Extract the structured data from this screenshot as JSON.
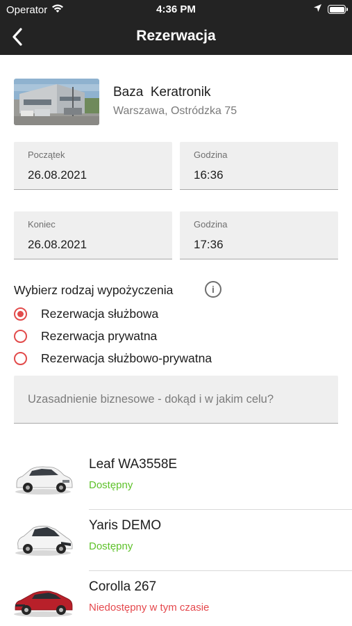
{
  "status_bar": {
    "carrier": "Operator",
    "time": "4:36 PM"
  },
  "nav": {
    "title": "Rezerwacja"
  },
  "location": {
    "name": "Baza  Keratronik",
    "address": "Warszawa, Ostródzka 75"
  },
  "start": {
    "date_label": "Początek",
    "date": "26.08.2021",
    "time_label": "Godzina",
    "time": "16:36"
  },
  "end": {
    "date_label": "Koniec",
    "date": "26.08.2021",
    "time_label": "Godzina",
    "time": "17:36"
  },
  "rental_type": {
    "title": "Wybierz rodzaj wypożyczenia",
    "options": [
      {
        "label": "Rezerwacja służbowa",
        "selected": true
      },
      {
        "label": "Rezerwacja prywatna",
        "selected": false
      },
      {
        "label": "Rezerwacja służbowo-prywatna",
        "selected": false
      }
    ]
  },
  "justification": {
    "placeholder": "Uzasadnienie biznesowe - dokąd i w jakim celu?"
  },
  "cars": [
    {
      "name": "Leaf WA3558E",
      "status": "Dostępny",
      "status_color": "#5ec22a",
      "body_color": "#f2f2f2"
    },
    {
      "name": "Yaris DEMO",
      "status": "Dostępny",
      "status_color": "#5ec22a",
      "body_color": "#f4f4f4"
    },
    {
      "name": "Corolla 267",
      "status": "Niedostępny w tym czasie",
      "status_color": "#e5484d",
      "body_color": "#b8202a"
    }
  ],
  "colors": {
    "accent": "#e24b4b",
    "header": "#232323"
  }
}
